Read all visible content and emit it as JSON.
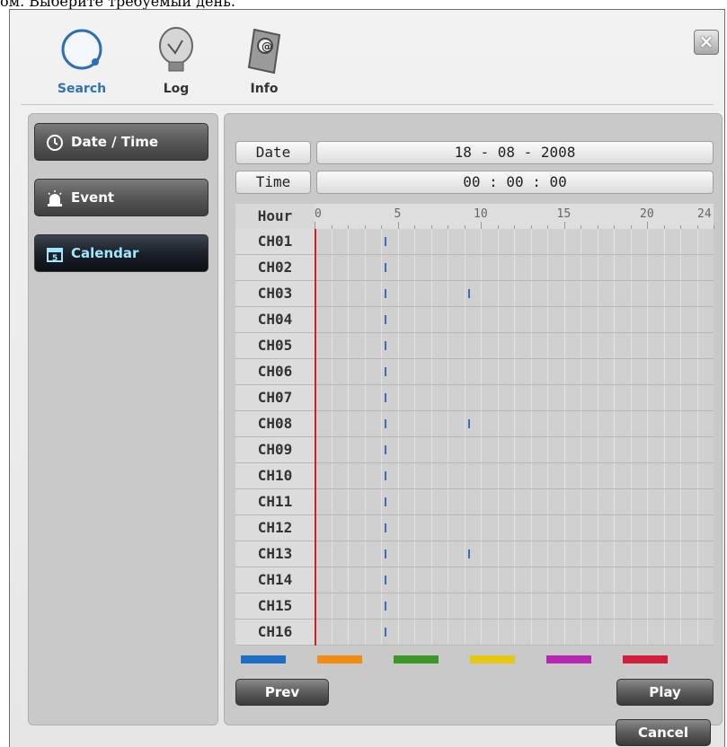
{
  "caption": "ом. Выберите требуемый день.",
  "toolbar": {
    "items": [
      {
        "label": "Search",
        "icon": "search-icon",
        "active": true
      },
      {
        "label": "Log",
        "icon": "log-icon",
        "active": false
      },
      {
        "label": "Info",
        "icon": "info-icon",
        "active": false
      }
    ],
    "close_label": "×"
  },
  "sidebar": {
    "items": [
      {
        "label": "Date / Time",
        "icon": "clock-icon",
        "active": false
      },
      {
        "label": "Event",
        "icon": "siren-icon",
        "active": false
      },
      {
        "label": "Calendar",
        "icon": "calendar-icon",
        "active": true,
        "icon_text": "5"
      }
    ]
  },
  "search": {
    "date_label": "Date",
    "date_value": "18 - 08 - 2008",
    "time_label": "Time",
    "time_value": "00 : 00 : 00"
  },
  "timeline": {
    "hour_label": "Hour",
    "hour_ticks": [
      "0",
      "5",
      "10",
      "15",
      "20",
      "24"
    ],
    "current_time_hour": 0,
    "channels": [
      {
        "name": "CH01",
        "recordings": [
          4
        ]
      },
      {
        "name": "CH02",
        "recordings": [
          4
        ]
      },
      {
        "name": "CH03",
        "recordings": [
          4,
          9
        ]
      },
      {
        "name": "CH04",
        "recordings": [
          4
        ]
      },
      {
        "name": "CH05",
        "recordings": [
          4
        ]
      },
      {
        "name": "CH06",
        "recordings": [
          4
        ]
      },
      {
        "name": "CH07",
        "recordings": [
          4
        ]
      },
      {
        "name": "CH08",
        "recordings": [
          4,
          9
        ]
      },
      {
        "name": "CH09",
        "recordings": [
          4
        ]
      },
      {
        "name": "CH10",
        "recordings": [
          4
        ]
      },
      {
        "name": "CH11",
        "recordings": [
          4
        ]
      },
      {
        "name": "CH12",
        "recordings": [
          4
        ]
      },
      {
        "name": "CH13",
        "recordings": [
          4,
          9
        ]
      },
      {
        "name": "CH14",
        "recordings": [
          4
        ]
      },
      {
        "name": "CH15",
        "recordings": [
          4
        ]
      },
      {
        "name": "CH16",
        "recordings": [
          4
        ]
      }
    ]
  },
  "legend_colors": [
    "#1e6ec8",
    "#f08c14",
    "#3c9628",
    "#e6c814",
    "#b428b4",
    "#d21e3c"
  ],
  "buttons": {
    "prev_label": "Prev",
    "play_label": "Play",
    "cancel_label": "Cancel"
  },
  "colors": {
    "current_time_line": "#cc2222",
    "recording_mark": "#3a6fb8",
    "active_label": "#2d72b7"
  }
}
